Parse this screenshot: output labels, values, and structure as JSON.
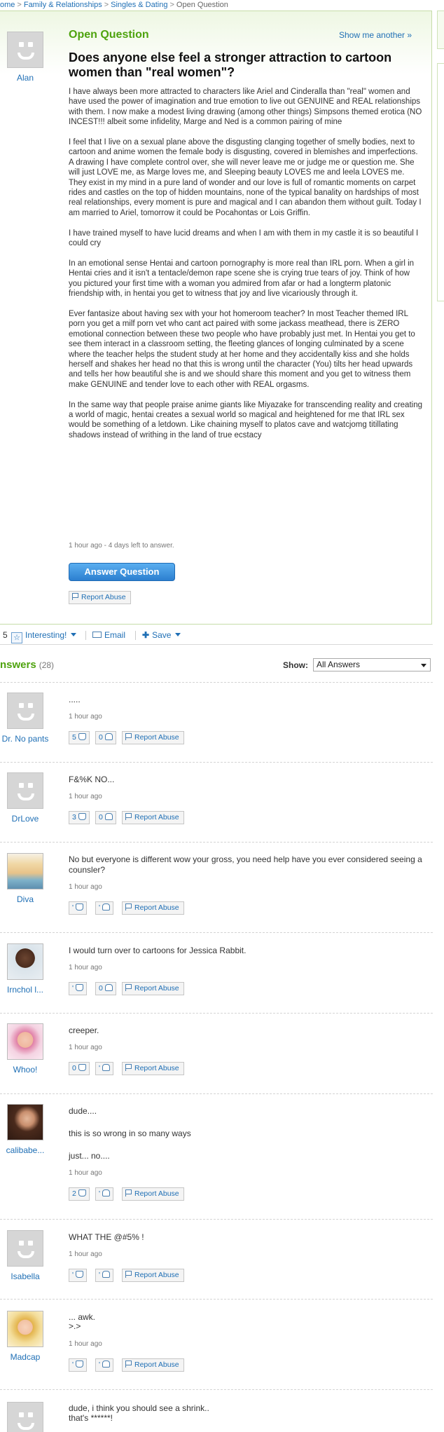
{
  "breadcrumb": {
    "home": "ome",
    "cat1": "Family & Relationships",
    "cat2": "Singles & Dating",
    "current": "Open Question"
  },
  "question": {
    "status": "Open Question",
    "show_another": "Show me another »",
    "asker": "Alan",
    "title": "Does anyone else feel a stronger attraction to cartoon women than \"real women\"?",
    "paragraphs": [
      "I have always been more attracted to characters like Ariel and Cinderalla than \"real\" women and have used the power of imagination and true emotion to live out GENUINE and REAL relationships with them. I now make a modest living drawing (among other things) Simpsons themed erotica (NO INCEST!!! albeit some infidelity, Marge and Ned is a common pairing of mine",
      "I feel that I live on a sexual plane above the disgusting clanging together of smelly bodies, next to cartoon and anime women the female body is disgusting, covered in blemishes and imperfections. A drawing I have complete control over, she will never leave me or judge me or question me. She will just LOVE me, as Marge loves me, and Sleeping beauty LOVES me and leela LOVES me. They exist in my mind in a pure land of wonder and our love is full of romantic moments on carpet rides and castles on the top of hidden mountains, none of the typical banality on hardships of most real relationships, every moment is pure and magical and I can abandon them without guilt. Today I am married to Ariel, tomorrow it could be Pocahontas or Lois Griffin.",
      "I have trained myself to have lucid dreams and when I am with them in my castle it is so beautiful I could cry",
      "In an emotional sense Hentai and cartoon pornography is more real than IRL porn. When a girl in Hentai cries and it isn't a tentacle/demon rape scene she is crying true tears of joy. Think of how you pictured your first time with a woman you admired from afar or had a longterm platonic friendship with, in hentai you get to witness that joy and live vicariously through it.",
      "Ever fantasize about having sex with your hot homeroom teacher? In most Teacher themed IRL porn you get a milf porn vet who cant act paired with some jackass meathead, there is ZERO emotional connection between these two people who have probably just met. In Hentai you get to see them interact in a classroom setting, the fleeting glances of longing culminated by a scene where the teacher helps the student study at her home and they accidentally kiss and she holds herself and shakes her head no that this is wrong until the character (You) tilts her head upwards and tells her how beautiful she is and we should share this moment and you get to witness them make GENUINE and tender love to each other with REAL orgasms.",
      "In the same way that people praise anime giants like Miyazake for transcending reality and creating a world of magic, hentai creates a sexual world so magical and heightened for me that IRL sex would be something of a letdown. Like chaining myself to platos cave and watcjomg titillating shadows instead of writhing in the land of true ecstacy"
    ],
    "meta": "1 hour ago - 4 days left to answer.",
    "answer_button": "Answer Question",
    "report_abuse": "Report Abuse"
  },
  "actions": {
    "count": "5",
    "interesting": "Interesting!",
    "email": "Email",
    "save": "Save"
  },
  "answers_header": {
    "label": "nswers",
    "count": "(28)",
    "show_label": "Show:",
    "show_value": "All Answers"
  },
  "answers": [
    {
      "name": "Dr. No pants",
      "lines": [
        "....."
      ],
      "time": "1 hour ago",
      "up": "5",
      "down": "0",
      "report": "Report Abuse"
    },
    {
      "name": "DrLove",
      "lines": [
        "F&%K NO..."
      ],
      "time": "1 hour ago",
      "up": "3",
      "down": "0",
      "report": "Report Abuse"
    },
    {
      "name": "Diva",
      "lines": [
        "No but everyone is different wow your gross, you need help have you ever considered seeing a counsler?"
      ],
      "time": "1 hour ago",
      "up": "'",
      "down": "'",
      "report": "Report Abuse"
    },
    {
      "name": "Irnchol l...",
      "lines": [
        "I would turn over to cartoons for Jessica Rabbit."
      ],
      "time": "1 hour ago",
      "up": "'",
      "down": "0",
      "report": "Report Abuse"
    },
    {
      "name": "Whoo!",
      "lines": [
        "creeper."
      ],
      "time": "1 hour ago",
      "up": "0",
      "down": "'",
      "report": "Report Abuse"
    },
    {
      "name": "calibabe...",
      "lines": [
        "dude....",
        "this is so wrong in so many ways",
        "just... no...."
      ],
      "time": "1 hour ago",
      "up": "2",
      "down": "'",
      "report": "Report Abuse"
    },
    {
      "name": "Isabella",
      "lines": [
        "WHAT THE @#5% !"
      ],
      "time": "1 hour ago",
      "up": "'",
      "down": "'",
      "report": "Report Abuse"
    },
    {
      "name": "Madcap",
      "lines": [
        "... awk.",
        ">.>"
      ],
      "time": "1 hour ago",
      "up": "'",
      "down": "'",
      "report": "Report Abuse"
    },
    {
      "name": "",
      "lines": [
        "dude, i think you should see a shrink..",
        "that's ******!"
      ],
      "time": "",
      "up": "",
      "down": "",
      "report": ""
    }
  ]
}
